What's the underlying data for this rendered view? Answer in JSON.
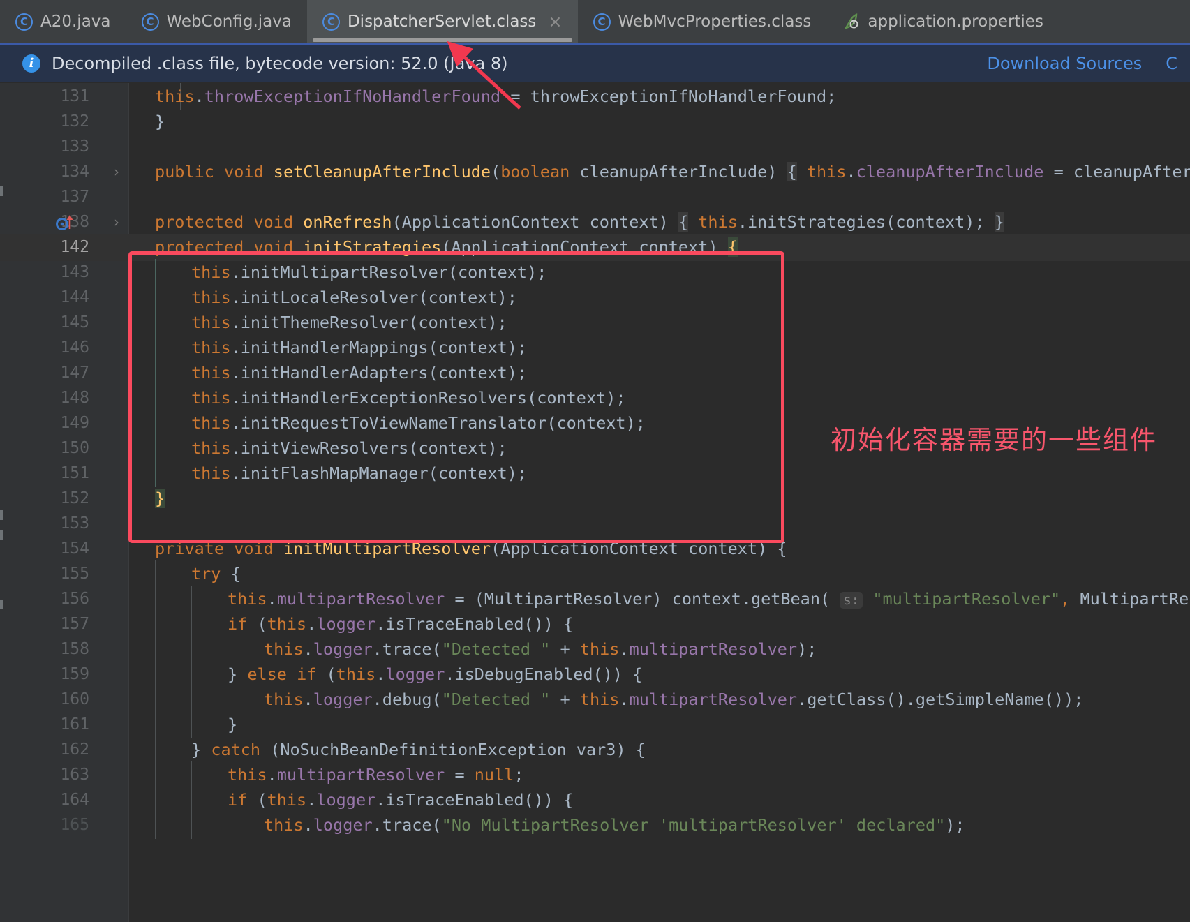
{
  "window": {
    "theme_background": "#2B2B2B",
    "accent": "#4C91E8"
  },
  "tabs": [
    {
      "label": "A20.java",
      "icon": "java-class-icon",
      "active": false,
      "closable": false
    },
    {
      "label": "WebConfig.java",
      "icon": "java-class-icon",
      "active": false,
      "closable": false
    },
    {
      "label": "DispatcherServlet.class",
      "icon": "java-class-icon",
      "active": true,
      "closable": true,
      "close_glyph": "×"
    },
    {
      "label": "WebMvcProperties.class",
      "icon": "java-class-icon",
      "active": false,
      "closable": false
    },
    {
      "label": "application.properties",
      "icon": "spring-leaf-icon",
      "active": false,
      "closable": false
    }
  ],
  "notification": {
    "icon": "info-icon",
    "message": "Decompiled .class file, bytecode version: 52.0 (Java 8)",
    "links": [
      {
        "label": "Download Sources"
      },
      {
        "label": "C"
      }
    ],
    "background": "#27334A",
    "link_color": "#4C91E8"
  },
  "annotations": {
    "chinese_note": "初始化容器需要的一些组件",
    "note_color": "#F7566C",
    "box_color": "#FA4A5E",
    "arrow_color": "#F2384F",
    "arrow_target": "DispatcherServlet.class tab"
  },
  "editor": {
    "language": "java",
    "syntax_colors": {
      "keyword": "#CC7832",
      "method": "#FFC66D",
      "field": "#9876AA",
      "string": "#6A8759",
      "identifier": "#A9B7C6",
      "line_number": "#606366"
    },
    "current_line": 142,
    "lines": [
      {
        "num": "131",
        "indent": 0
      },
      {
        "num": "132",
        "indent": 0
      },
      {
        "num": "133",
        "indent": 0
      },
      {
        "num": "134",
        "indent": 0,
        "fold": "›"
      },
      {
        "num": "137",
        "indent": 0
      },
      {
        "num": "138",
        "indent": 0,
        "fold": "›",
        "gutter_icon": "overriding-method-icon"
      },
      {
        "num": "142",
        "indent": 0
      },
      {
        "num": "143",
        "indent": 0
      },
      {
        "num": "144",
        "indent": 0
      },
      {
        "num": "145",
        "indent": 0
      },
      {
        "num": "146",
        "indent": 0
      },
      {
        "num": "147",
        "indent": 0
      },
      {
        "num": "148",
        "indent": 0
      },
      {
        "num": "149",
        "indent": 0
      },
      {
        "num": "150",
        "indent": 0
      },
      {
        "num": "151",
        "indent": 0
      },
      {
        "num": "152",
        "indent": 0
      },
      {
        "num": "153",
        "indent": 0
      },
      {
        "num": "154",
        "indent": 0
      },
      {
        "num": "155",
        "indent": 0
      },
      {
        "num": "156",
        "indent": 0
      },
      {
        "num": "157",
        "indent": 0
      },
      {
        "num": "158",
        "indent": 0
      },
      {
        "num": "159",
        "indent": 0
      },
      {
        "num": "160",
        "indent": 0
      },
      {
        "num": "161",
        "indent": 0
      },
      {
        "num": "162",
        "indent": 0
      },
      {
        "num": "163",
        "indent": 0
      },
      {
        "num": "164",
        "indent": 0
      },
      {
        "num": "165",
        "indent": 0
      }
    ],
    "code_text": {
      "l131": "        this.throwExceptionIfNoHandlerFound = throwExceptionIfNoHandlerFound;",
      "l132": "    }",
      "l133": "",
      "l134": "    public void setCleanupAfterInclude(boolean cleanupAfterInclude) { this.cleanupAfterInclude = cleanupAfter",
      "l137": "",
      "l138": "    protected void onRefresh(ApplicationContext context) { this.initStrategies(context); }",
      "l142": "    protected void initStrategies(ApplicationContext context) {",
      "l143": "        this.initMultipartResolver(context);",
      "l144": "        this.initLocaleResolver(context);",
      "l145": "        this.initThemeResolver(context);",
      "l146": "        this.initHandlerMappings(context);",
      "l147": "        this.initHandlerAdapters(context);",
      "l148": "        this.initHandlerExceptionResolvers(context);",
      "l149": "        this.initRequestToViewNameTranslator(context);",
      "l150": "        this.initViewResolvers(context);",
      "l151": "        this.initFlashMapManager(context);",
      "l152": "    }",
      "l153": "",
      "l154": "    private void initMultipartResolver(ApplicationContext context) {",
      "l155": "        try {",
      "l156": "            this.multipartResolver = (MultipartResolver) context.getBean( s: \"multipartResolver\", MultipartRes",
      "l157": "            if (this.logger.isTraceEnabled()) {",
      "l158": "                this.logger.trace(\"Detected \" + this.multipartResolver);",
      "l159": "            } else if (this.logger.isDebugEnabled()) {",
      "l160": "                this.logger.debug(\"Detected \" + this.multipartResolver.getClass().getSimpleName());",
      "l161": "            }",
      "l162": "        } catch (NoSuchBeanDefinitionException var3) {",
      "l163": "            this.multipartResolver = null;",
      "l164": "            if (this.logger.isTraceEnabled()) {",
      "l165": "                this.logger.trace(\"No MultipartResolver 'multipartResolver' declared\");"
    },
    "parameter_hint": "s:"
  }
}
